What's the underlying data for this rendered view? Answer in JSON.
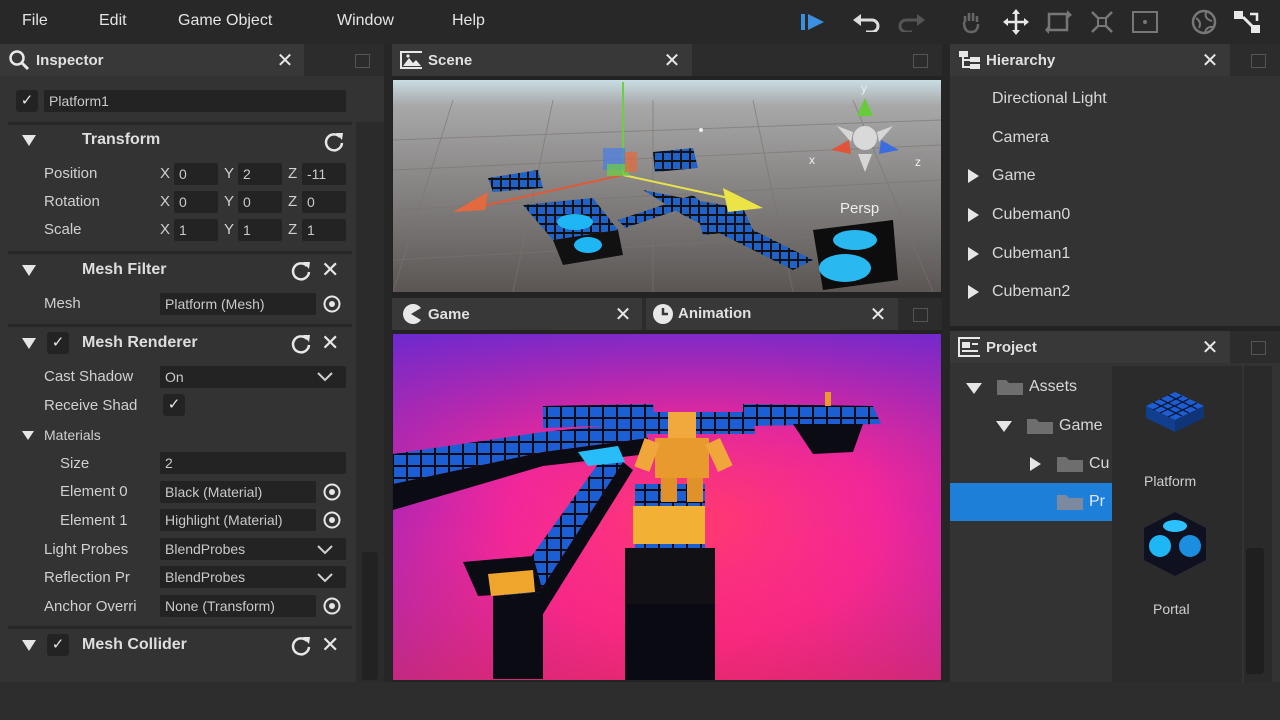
{
  "menubar": {
    "items": [
      "File",
      "Edit",
      "Game Object",
      "Window",
      "Help"
    ],
    "tools": [
      "play-icon",
      "undo-icon",
      "redo-icon",
      "hand-icon",
      "move-icon",
      "rotate-icon",
      "scale-icon",
      "rect-icon",
      "global-icon",
      "layout-icon"
    ]
  },
  "inspector": {
    "title": "Inspector",
    "object_name": "Platform1",
    "transform": {
      "title": "Transform",
      "position_label": "Position",
      "rotation_label": "Rotation",
      "scale_label": "Scale",
      "axes": [
        "X",
        "Y",
        "Z"
      ],
      "position": [
        "0",
        "2",
        "-11"
      ],
      "rotation": [
        "0",
        "0",
        "0"
      ],
      "scale": [
        "1",
        "1",
        "1"
      ]
    },
    "mesh_filter": {
      "title": "Mesh Filter",
      "mesh_label": "Mesh",
      "mesh_value": "Platform (Mesh)"
    },
    "mesh_renderer": {
      "title": "Mesh Renderer",
      "cast_shadow_label": "Cast Shadow",
      "cast_shadow_value": "On",
      "receive_shadow_label": "Receive Shad",
      "materials_label": "Materials",
      "size_label": "Size",
      "size_value": "2",
      "element0_label": "Element 0",
      "element0_value": "Black (Material)",
      "element1_label": "Element 1",
      "element1_value": "Highlight (Material)",
      "light_probes_label": "Light Probes",
      "light_probes_value": "BlendProbes",
      "reflection_label": "Reflection Pr",
      "reflection_value": "BlendProbes",
      "anchor_label": "Anchor Overri",
      "anchor_value": "None (Transform)"
    },
    "mesh_collider": {
      "title": "Mesh Collider"
    }
  },
  "scene": {
    "title": "Scene",
    "persp_label": "Persp",
    "gizmo_axes": [
      "y",
      "x",
      "z"
    ]
  },
  "game": {
    "title": "Game"
  },
  "animation": {
    "title": "Animation"
  },
  "hierarchy": {
    "title": "Hierarchy",
    "items": [
      {
        "label": "Directional Light",
        "expandable": false
      },
      {
        "label": "Camera",
        "expandable": false
      },
      {
        "label": "Game",
        "expandable": true
      },
      {
        "label": "Cubeman0",
        "expandable": true
      },
      {
        "label": "Cubeman1",
        "expandable": true
      },
      {
        "label": "Cubeman2",
        "expandable": true
      }
    ]
  },
  "project": {
    "title": "Project",
    "tree": [
      {
        "label": "Assets"
      },
      {
        "label": "Game"
      },
      {
        "label": "Cu"
      },
      {
        "label": "Pr"
      }
    ],
    "assets": [
      {
        "label": "Platform"
      },
      {
        "label": "Portal"
      }
    ]
  },
  "colors": {
    "accent": "#1e7fd8",
    "panel": "#333333",
    "header": "#383838"
  }
}
